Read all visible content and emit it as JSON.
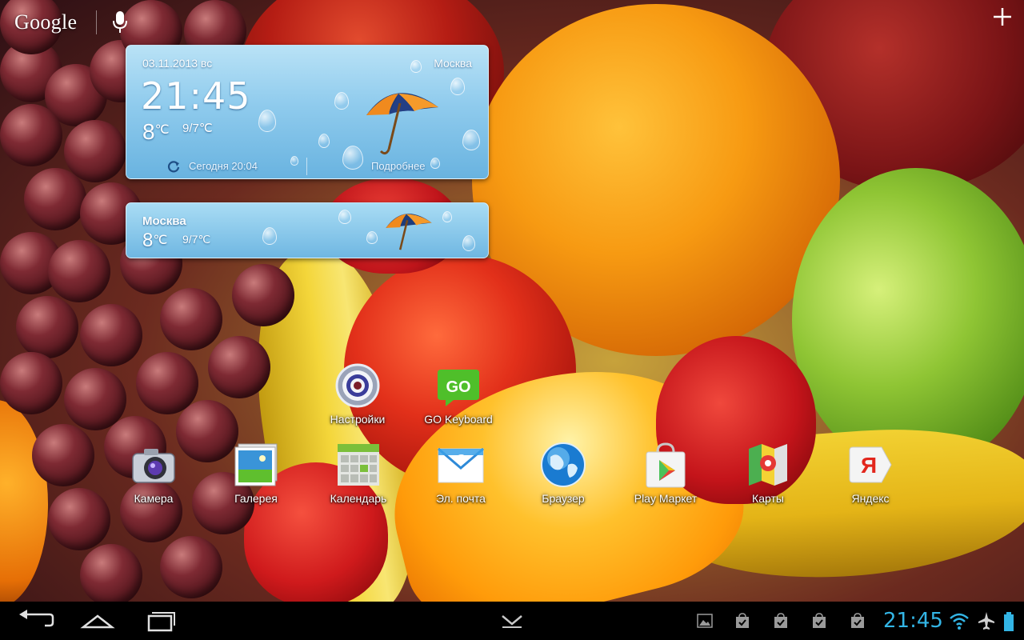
{
  "top_bar": {
    "search_label": "Google"
  },
  "weather_widget": {
    "date": "03.11.2013 вс",
    "city": "Москва",
    "time": "21:45",
    "temp": "8",
    "temp_unit": "℃",
    "range": "9/7℃",
    "updated": "Сегодня 20:04",
    "more": "Подробнее"
  },
  "weather_small": {
    "city": "Москва",
    "temp": "8",
    "temp_unit": "℃",
    "range": "9/7℃"
  },
  "apps_row1": [
    {
      "label": "Настройки",
      "icon": "settings-icon"
    },
    {
      "label": "GO Keyboard",
      "icon": "go-keyboard-icon"
    }
  ],
  "dock": [
    {
      "label": "Камера",
      "icon": "camera-icon"
    },
    {
      "label": "Галерея",
      "icon": "gallery-icon"
    },
    {
      "label": "Календарь",
      "icon": "calendar-icon"
    },
    {
      "label": "Эл. почта",
      "icon": "email-icon"
    },
    {
      "label": "Браузер",
      "icon": "browser-icon"
    },
    {
      "label": "Play Маркет",
      "icon": "play-market-icon"
    },
    {
      "label": "Карты",
      "icon": "maps-icon"
    },
    {
      "label": "Яндекс",
      "icon": "yandex-icon"
    }
  ],
  "status_bar": {
    "time": "21:45",
    "accent": "#33b5e5"
  },
  "icons": {
    "wifi": "wifi-icon",
    "airplane": "airplane-icon",
    "back": "back-icon",
    "home": "home-icon",
    "recents": "recents-icon"
  }
}
